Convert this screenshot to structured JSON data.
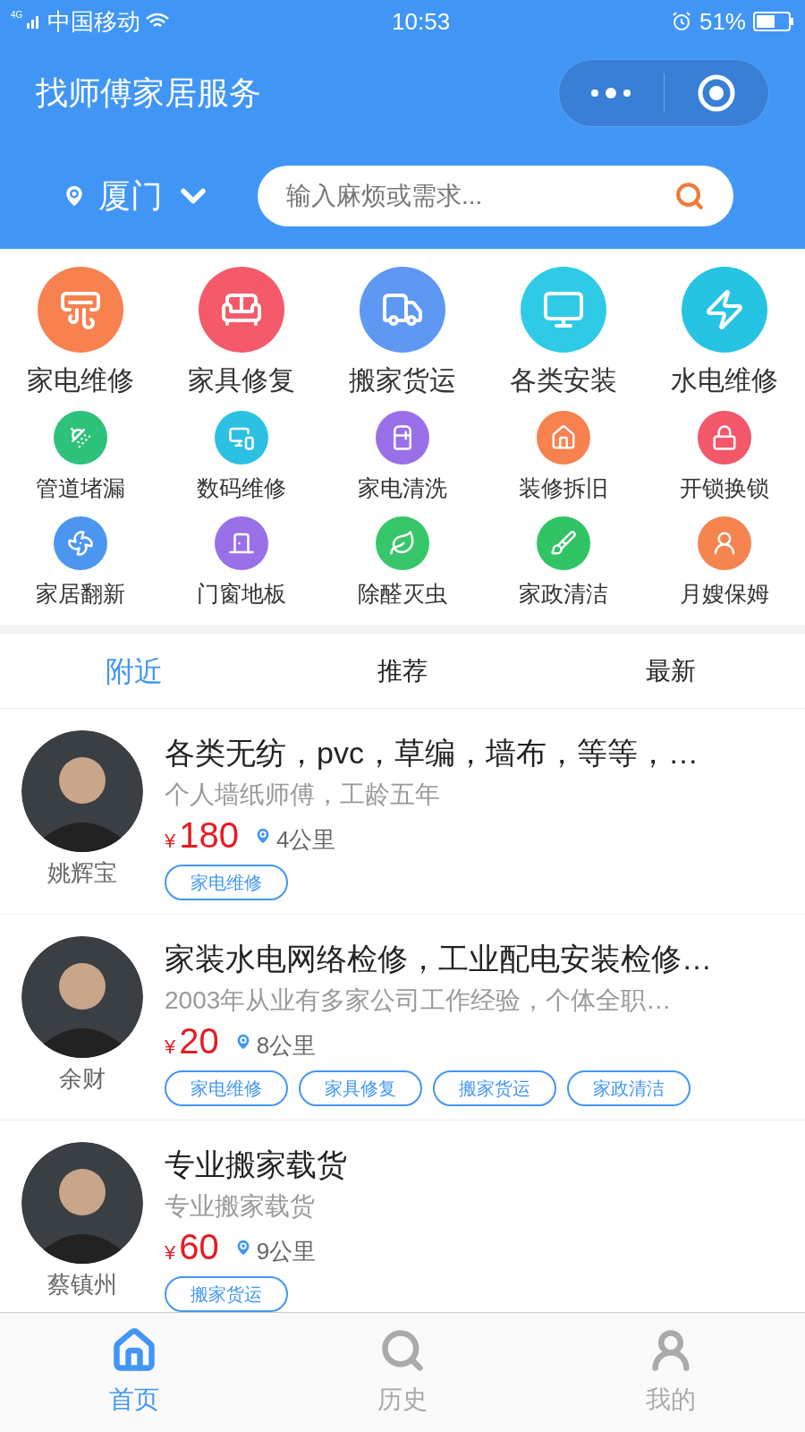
{
  "status_bar": {
    "network": "4G",
    "carrier": "中国移动",
    "time": "10:53",
    "battery": "51%"
  },
  "header": {
    "title": "找师傅家居服务",
    "city": "厦门",
    "search": {
      "placeholder": "输入麻烦或需求..."
    }
  },
  "main_categories": [
    {
      "label": "家电维修",
      "color": "#f7814f"
    },
    {
      "label": "家具修复",
      "color": "#f45a6a"
    },
    {
      "label": "搬家货运",
      "color": "#5f98f3"
    },
    {
      "label": "各类安装",
      "color": "#2fcbe6"
    },
    {
      "label": "水电维修",
      "color": "#27c3e3"
    }
  ],
  "sub_categories": [
    {
      "label": "管道堵漏",
      "color": "#2ec27a"
    },
    {
      "label": "数码维修",
      "color": "#2cc0e2"
    },
    {
      "label": "家电清洗",
      "color": "#9a70e9"
    },
    {
      "label": "装修拆旧",
      "color": "#f7814f"
    },
    {
      "label": "开锁换锁",
      "color": "#f2576a"
    },
    {
      "label": "家居翻新",
      "color": "#4d96ef"
    },
    {
      "label": "门窗地板",
      "color": "#9a70e9"
    },
    {
      "label": "除醛灭虫",
      "color": "#37c76a"
    },
    {
      "label": "家政清洁",
      "color": "#30c465"
    },
    {
      "label": "月嫂保姆",
      "color": "#f6844f"
    }
  ],
  "tabs": [
    {
      "label": "附近",
      "selected": true
    },
    {
      "label": "推荐",
      "selected": false
    },
    {
      "label": "最新",
      "selected": false
    }
  ],
  "workers": [
    {
      "name": "姚辉宝",
      "title": "各类无纺，pvc，草编，墙布，等等，…",
      "description": "个人墙纸师傅，工龄五年",
      "currency": "¥",
      "price": "180",
      "distance": "4公里",
      "tags": [
        "家电维修"
      ]
    },
    {
      "name": "余财",
      "title": "家装水电网络检修，工业配电安装检修…",
      "description": "2003年从业有多家公司工作经验，个体全职…",
      "currency": "¥",
      "price": "20",
      "distance": "8公里",
      "tags": [
        "家电维修",
        "家具修复",
        "搬家货运",
        "家政清洁"
      ]
    },
    {
      "name": "蔡镇州",
      "title": "专业搬家载货",
      "description": "专业搬家载货",
      "currency": "¥",
      "price": "60",
      "distance": "9公里",
      "tags": [
        "搬家货运"
      ]
    }
  ],
  "tab_bar": [
    {
      "label": "首页",
      "selected": true
    },
    {
      "label": "历史",
      "selected": false
    },
    {
      "label": "我的",
      "selected": false
    }
  ]
}
